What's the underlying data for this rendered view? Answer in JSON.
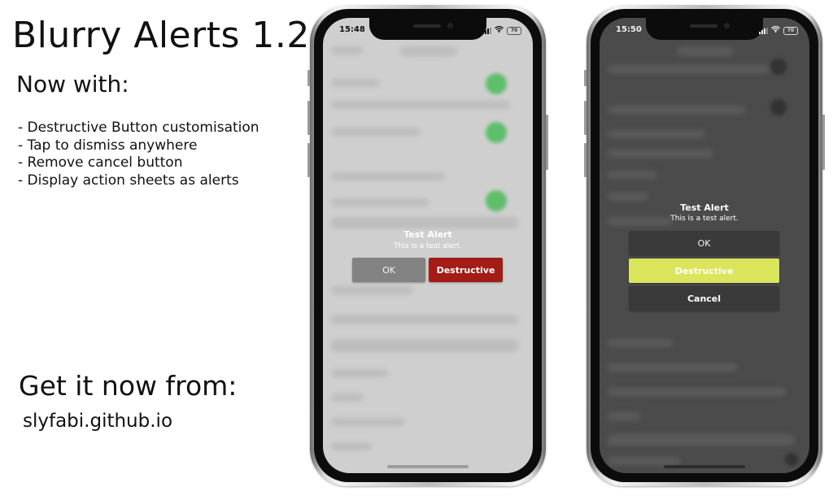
{
  "promo": {
    "title": "Blurry Alerts 1.2",
    "subtitle": "Now with:",
    "features": [
      "- Destructive Button customisation",
      "- Tap to dismiss anywhere",
      "- Remove cancel button",
      "- Display action sheets as alerts"
    ],
    "cta": "Get it now from:",
    "link": "slyfabi.github.io"
  },
  "phone_light": {
    "time": "15:48",
    "battery": "70",
    "alert": {
      "title": "Test Alert",
      "message": "This is a test alert.",
      "ok_label": "OK",
      "destructive_label": "Destructive"
    },
    "colors": {
      "destructive": "#a31d16",
      "ok": "#828282",
      "toggle": "#5fbe6a"
    }
  },
  "phone_dark": {
    "time": "15:50",
    "battery": "70",
    "alert": {
      "title": "Test Alert",
      "message": "This is a test alert.",
      "ok_label": "OK",
      "destructive_label": "Destructive",
      "cancel_label": "Cancel"
    },
    "colors": {
      "destructive": "#dbe55c",
      "button": "#3a3a3a"
    }
  }
}
